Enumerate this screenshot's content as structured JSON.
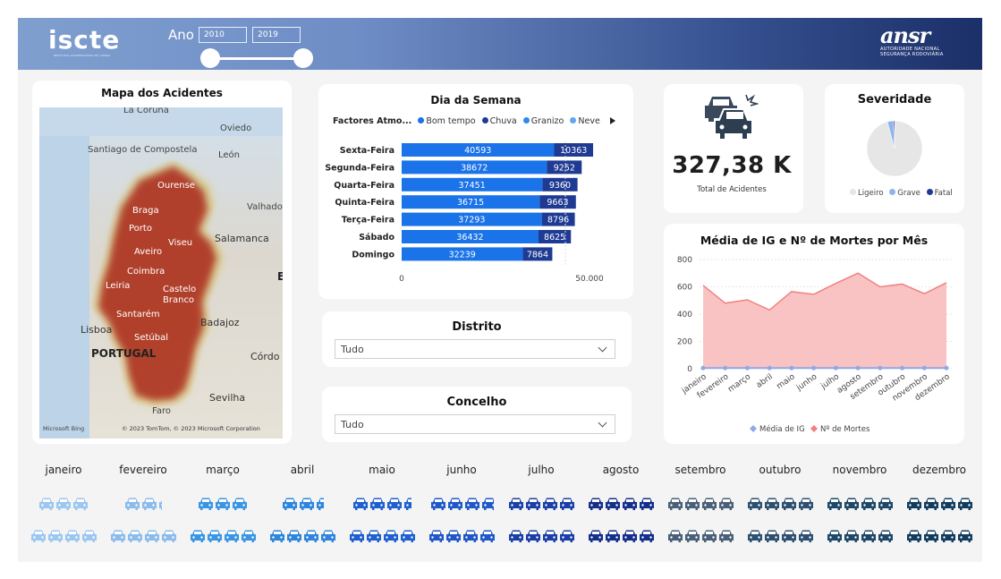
{
  "header": {
    "logo_text": "iscte",
    "logo_sub": "INSTITUTO UNIVERSITÁRIO DE LISBOA",
    "ano_label": "Ano",
    "year_from": "2010",
    "year_to": "2019",
    "ansr_word": "ansr",
    "ansr_sub1": "AUTORIDADE NACIONAL",
    "ansr_sub2": "SEGURANÇA RODOVIÁRIA"
  },
  "map": {
    "title": "Mapa dos Acidentes",
    "places": [
      "La Coruña",
      "Oviedo",
      "Santiago de Compostela",
      "León",
      "Ourense",
      "Braga",
      "Porto",
      "Valhado",
      "Aveiro",
      "Viseu",
      "Salamanca",
      "Coimbra",
      "Leiria",
      "Castelo Branco",
      "Santarém",
      "Badajoz",
      "Lisboa",
      "Setúbal",
      "PORTUGAL",
      "Córdo",
      "Sevilha",
      "Faro",
      "E"
    ],
    "bing": "Microsoft Bing",
    "credit": "© 2023 TomTom, © 2023 Microsoft Corporation"
  },
  "weekday_chart": {
    "title": "Dia da Semana",
    "legend_label": "Factores Atmo...",
    "legend_items": [
      "Bom tempo",
      "Chuva",
      "Granizo",
      "Neve"
    ],
    "legend_colors": [
      "#1a73e8",
      "#1f3a93",
      "#2e8be6",
      "#5fa8ef"
    ],
    "axis_ticks": [
      "0",
      "50.000"
    ]
  },
  "chart_data": [
    {
      "type": "bar",
      "orientation": "horizontal",
      "stacked": true,
      "title": "Dia da Semana",
      "categories": [
        "Sexta-Feira",
        "Segunda-Feira",
        "Quarta-Feira",
        "Quinta-Feira",
        "Terça-Feira",
        "Sábado",
        "Domingo"
      ],
      "series": [
        {
          "name": "Bom tempo",
          "color": "#1a73e8",
          "values": [
            40593,
            38672,
            37451,
            36715,
            37293,
            36432,
            32239
          ]
        },
        {
          "name": "Chuva",
          "color": "#1f3a93",
          "values": [
            10363,
            9252,
            9360,
            9663,
            8796,
            8625,
            7864
          ]
        }
      ],
      "xlim": [
        0,
        60000
      ],
      "xticks": [
        0,
        50000
      ]
    },
    {
      "type": "pie",
      "title": "Severidade",
      "labels": [
        "Ligeiro",
        "Grave",
        "Fatal"
      ],
      "values": [
        95.9,
        3.4,
        0.7
      ],
      "colors": [
        "#e6e6e6",
        "#8fb3ec",
        "#1f3a93"
      ]
    },
    {
      "type": "area",
      "title": "Média de IG e Nº de Mortes por Mês",
      "categories": [
        "janeiro",
        "fevereiro",
        "março",
        "abril",
        "maio",
        "junho",
        "julho",
        "agosto",
        "setembro",
        "outubro",
        "novembro",
        "dezembro"
      ],
      "series": [
        {
          "name": "Média de IG",
          "color": "#8fa8e8",
          "values": [
            5,
            5,
            5,
            5,
            5,
            5,
            5,
            5,
            5,
            5,
            5,
            5
          ]
        },
        {
          "name": "Nº de Mortes",
          "color": "#f08080",
          "values": [
            610,
            480,
            505,
            430,
            565,
            545,
            625,
            700,
            600,
            620,
            550,
            630
          ]
        }
      ],
      "ylim": [
        0,
        800
      ],
      "yticks": [
        0,
        200,
        400,
        600,
        800
      ],
      "legend": "bottom"
    }
  ],
  "distrito": {
    "title": "Distrito",
    "value": "Tudo"
  },
  "concelho": {
    "title": "Concelho",
    "value": "Tudo"
  },
  "kpi": {
    "value": "327,38 K",
    "label": "Total de Acidentes"
  },
  "severity": {
    "title": "Severidade",
    "legend": [
      "Ligeiro",
      "Grave",
      "Fatal"
    ]
  },
  "monthly_chart": {
    "title": "Média de IG e Nº de Mortes por Mês",
    "legend": [
      "Média de IG",
      "Nº de Mortes"
    ]
  },
  "months": {
    "labels": [
      "janeiro",
      "fevereiro",
      "março",
      "abril",
      "maio",
      "junho",
      "julho",
      "agosto",
      "setembro",
      "outubro",
      "novembro",
      "dezembro"
    ],
    "colors": [
      "#9cc7f0",
      "#8bbcec",
      "#3a96e4",
      "#2e86dc",
      "#1f5fd0",
      "#2058c8",
      "#1a3fa8",
      "#142f8c",
      "#4a5f78",
      "#2e5070",
      "#1e4868",
      "#123c5e"
    ],
    "row1_cars": [
      3,
      2.2,
      3,
      2.5,
      3.5,
      3.8,
      4,
      4,
      4,
      4,
      4,
      4
    ],
    "row2_cars": [
      4,
      4,
      4,
      4,
      4,
      4,
      4,
      4,
      4,
      4,
      4,
      4
    ]
  }
}
